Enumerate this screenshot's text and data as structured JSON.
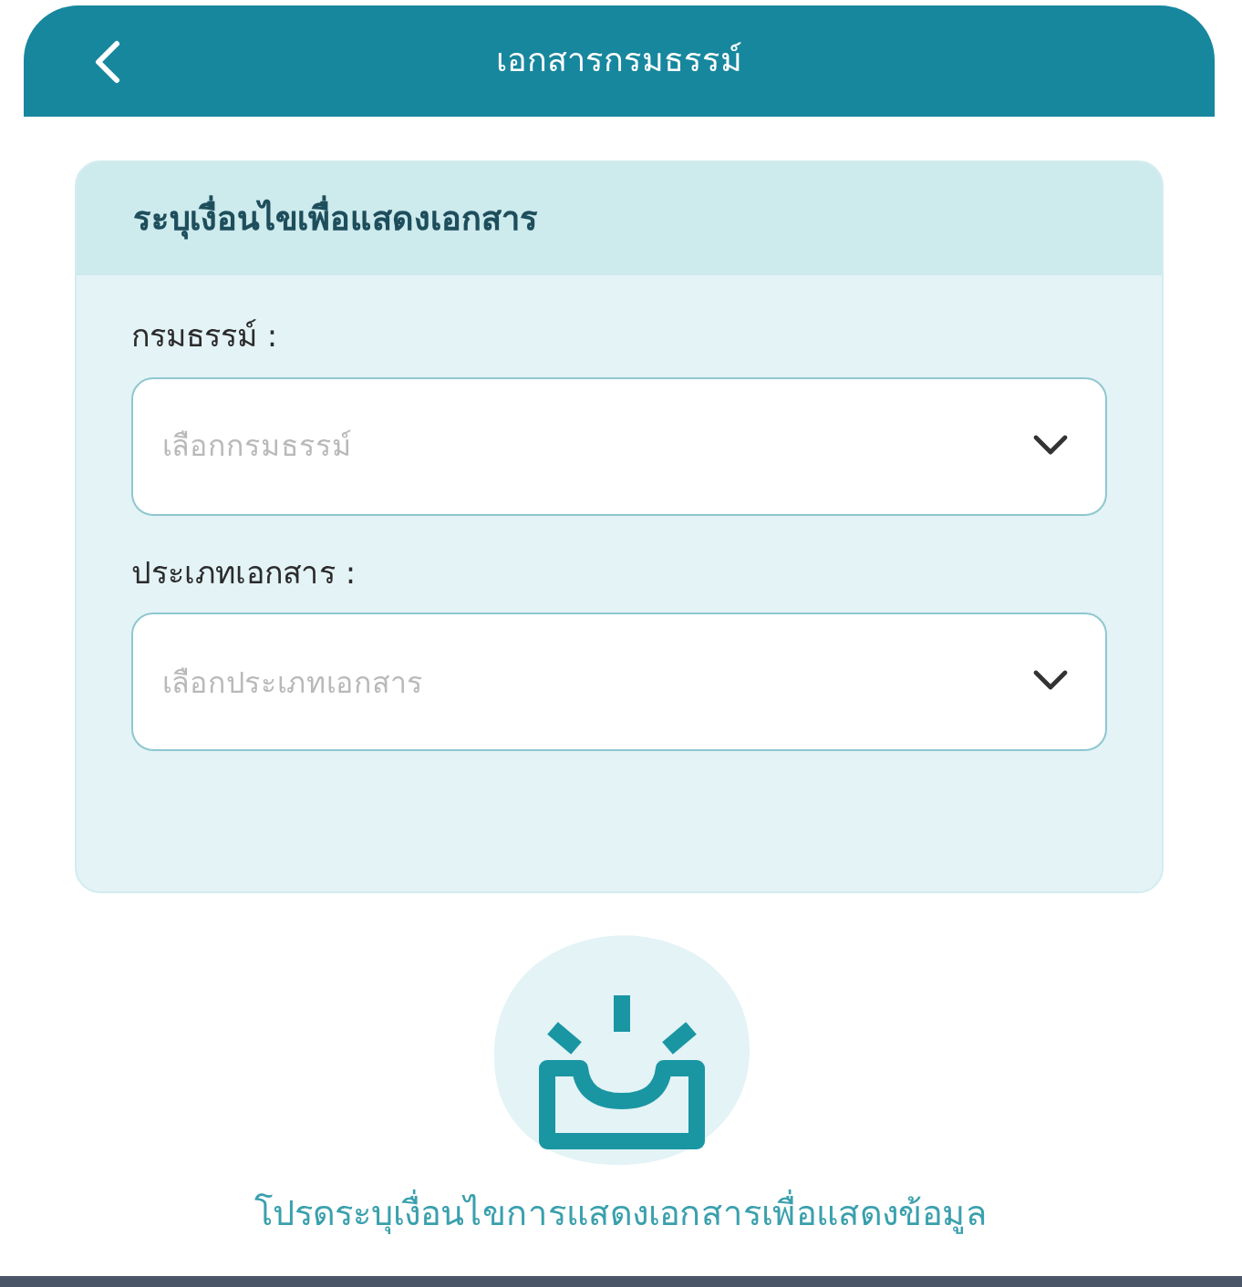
{
  "header": {
    "title": "เอกสารกรมธรรม์"
  },
  "filter_card": {
    "title": "ระบุเงื่อนไขเพื่อแสดงเอกสาร",
    "fields": [
      {
        "label": "กรมธรรม์ :",
        "placeholder": "เลือกกรมธรรม์"
      },
      {
        "label": "ประเภทเอกสาร :",
        "placeholder": "เลือกประเภทเอกสาร"
      }
    ]
  },
  "empty_state": {
    "message": "โปรดระบุเงื่อนไขการแสดงเอกสารเพื่อแสดงข้อมูล"
  }
}
